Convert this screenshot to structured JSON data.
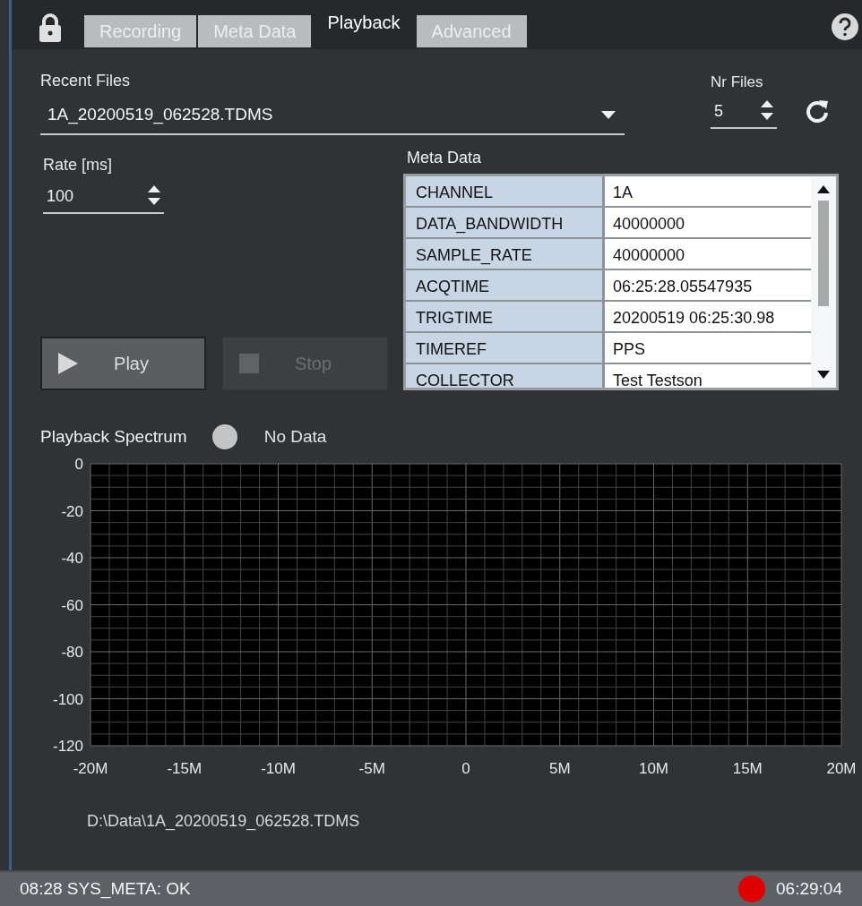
{
  "tabs": [
    {
      "label": "Recording",
      "selected": false
    },
    {
      "label": "Meta Data",
      "selected": false
    },
    {
      "label": "Playback",
      "selected": true
    },
    {
      "label": "Advanced",
      "selected": false
    }
  ],
  "recent_files": {
    "label": "Recent Files",
    "value": "1A_20200519_062528.TDMS"
  },
  "nr_files": {
    "label": "Nr Files",
    "value": "5"
  },
  "rate": {
    "label": "Rate [ms]",
    "value": "100"
  },
  "meta_data": {
    "title": "Meta Data",
    "rows": [
      {
        "key": "CHANNEL",
        "value": "1A"
      },
      {
        "key": "DATA_BANDWIDTH",
        "value": "40000000"
      },
      {
        "key": "SAMPLE_RATE",
        "value": "40000000"
      },
      {
        "key": "ACQTIME",
        "value": "06:25:28.05547935"
      },
      {
        "key": "TRIGTIME",
        "value": "20200519 06:25:30.98"
      },
      {
        "key": "TIMEREF",
        "value": "PPS"
      },
      {
        "key": "COLLECTOR",
        "value": "Test Testson"
      }
    ]
  },
  "buttons": [
    {
      "label": "Play",
      "kind": "play",
      "disabled": false
    },
    {
      "label": "Stop",
      "kind": "stop",
      "disabled": true
    }
  ],
  "spectrum": {
    "title": "Playback Spectrum",
    "indicator": {
      "label": "No Data",
      "on": false
    },
    "chart_data": {
      "type": "line",
      "grid": true,
      "xlim": [
        -20,
        20
      ],
      "ylim": [
        -120,
        0
      ],
      "xticks": [
        {
          "value": -20,
          "label": "-20M"
        },
        {
          "value": -15,
          "label": "-15M"
        },
        {
          "value": -10,
          "label": "-10M"
        },
        {
          "value": -5,
          "label": "-5M"
        },
        {
          "value": 0,
          "label": "0"
        },
        {
          "value": 5,
          "label": "5M"
        },
        {
          "value": 10,
          "label": "10M"
        },
        {
          "value": 15,
          "label": "15M"
        },
        {
          "value": 20,
          "label": "20M"
        }
      ],
      "yticks": [
        0,
        -20,
        -40,
        -60,
        -80,
        -100,
        -120
      ]
    }
  },
  "file_path": "D:\\Data\\1A_20200519_062528.TDMS",
  "status_bar": {
    "message": "08:28 SYS_META: OK",
    "recording_dot": {
      "color": "#e00000"
    },
    "time": "06:29:04"
  }
}
